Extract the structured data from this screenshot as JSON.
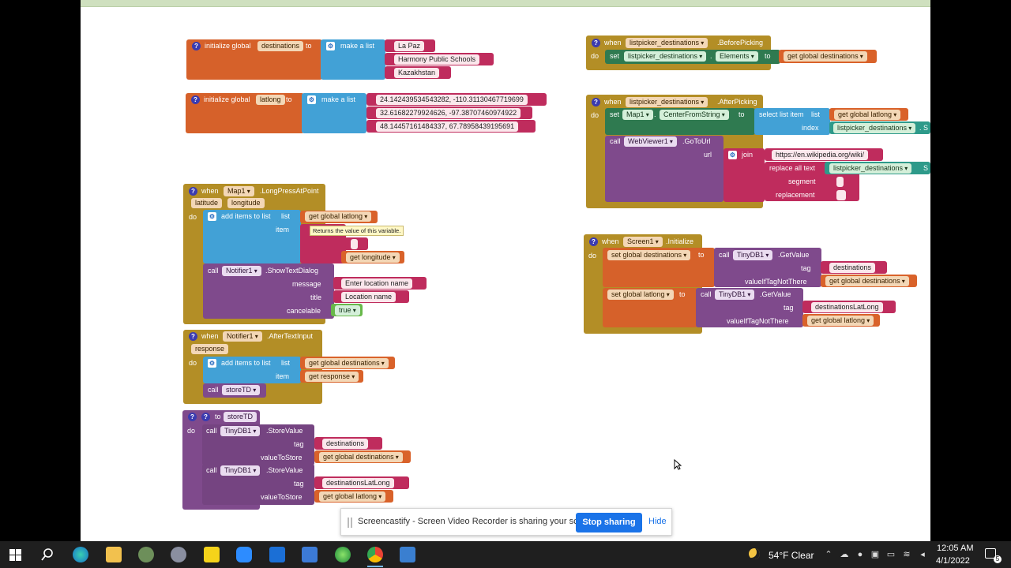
{
  "workspace": {
    "init_destinations": {
      "header": "initialize global",
      "var_name": "destinations",
      "to": "to",
      "make_list": "make a list",
      "items": [
        "La Paz",
        "Harmony Public Schools",
        "Kazakhstan"
      ]
    },
    "init_latlong": {
      "header": "initialize global",
      "var_name": "latlong",
      "to": "to",
      "make_list": "make a list",
      "items": [
        "24.142439534543282, -110.31130467719699",
        "32.61682279924626, -97.38707460974922",
        "48.14457161484337, 67.78958439195691"
      ]
    },
    "before_picking": {
      "when": "when",
      "component": "listpicker_destinations",
      "event": ".BeforePicking",
      "do": "do",
      "set": "set",
      "target": "listpicker_destinations",
      "dot": ".",
      "property": "Elements",
      "to": "to",
      "get": "get global destinations"
    },
    "after_picking": {
      "when": "when",
      "component": "listpicker_destinations",
      "event": ".AfterPicking",
      "do": "do",
      "set": "set",
      "map": "Map1",
      "dot": ".",
      "property": "CenterFromString",
      "to": "to",
      "select_list_item": "select list item",
      "list": "list",
      "get_latlong": "get global latlong",
      "index": "index",
      "index_value": "listpicker_destinations",
      "index_cut": ". S",
      "call": "call",
      "webviewer": "WebViewer1",
      "goto": ".GoToUrl",
      "url": "url",
      "join": "join",
      "wiki": "https://en.wikipedia.org/wiki/",
      "replace_all": "replace all text",
      "replace_value": "listpicker_destinations",
      "replace_cut": "S",
      "segment": "segment",
      "replacement": "replacement"
    },
    "long_press": {
      "when": "when",
      "component": "Map1",
      "event": ".LongPressAtPoint",
      "param1": "latitude",
      "param2": "longitude",
      "do": "do",
      "add_items": "add items to list",
      "list": "list",
      "get_latlong": "get global latlong",
      "item": "item",
      "tooltip": "Returns the value of this variable.",
      "get_longitude": "get longitude",
      "call": "call",
      "notifier": "Notifier1",
      "show_dialog": ".ShowTextDialog",
      "message": "message",
      "message_value": "Enter location name",
      "title": "title",
      "title_value": "Location name",
      "cancelable": "cancelable",
      "cancelable_value": "true"
    },
    "after_text_input": {
      "when": "when",
      "component": "Notifier1",
      "event": ".AfterTextInput",
      "param": "response",
      "do": "do",
      "add_items": "add items to list",
      "list": "list",
      "get_destinations": "get global destinations",
      "item": "item",
      "get_response": "get response",
      "call": "call",
      "proc": "storeTD"
    },
    "store_td": {
      "to": "to",
      "name": "storeTD",
      "do": "do",
      "call1": "call",
      "db1": "TinyDB1",
      "store1": ".StoreValue",
      "tag1": "tag",
      "tag1_value": "destinations",
      "vts1": "valueToStore",
      "get1": "get global destinations",
      "call2": "call",
      "db2": "TinyDB1",
      "store2": ".StoreValue",
      "tag2": "tag",
      "tag2_value": "destinationsLatLong",
      "vts2": "valueToStore",
      "get2": "get global latlong"
    },
    "screen_init": {
      "when": "when",
      "component": "Screen1",
      "event": ".Initialize",
      "do": "do",
      "set1": "set global destinations",
      "to1": "to",
      "call1": "call",
      "db1": "TinyDB1",
      "get_value1": ".GetValue",
      "tag1": "tag",
      "tag1_value": "destinations",
      "vitnt1": "valueIfTagNotThere",
      "default1": "get global destinations",
      "set2": "set global latlong",
      "to2": "to",
      "call2": "call",
      "db2": "TinyDB1",
      "get_value2": ".GetValue",
      "tag2": "tag",
      "tag2_value": "destinationsLatLong",
      "vitnt2": "valueIfTagNotThere",
      "default2": "get global latlong"
    }
  },
  "sharebar": {
    "message": "Screencastify - Screen Video Recorder is sharing your screen.",
    "stop": "Stop sharing",
    "hide": "Hide"
  },
  "taskbar": {
    "weather": "54°F  Clear",
    "time": "12:05 AM",
    "date": "4/1/2022",
    "notifications": "5"
  },
  "colors": {
    "init_orange": "#d6612a",
    "list_blue": "#42a1d6",
    "text_red": "#bf2c5d",
    "event_gold": "#b38e26",
    "proc_purple": "#7f4a8c",
    "map_green": "#2f7a50",
    "stop_blue": "#1a73e8"
  }
}
